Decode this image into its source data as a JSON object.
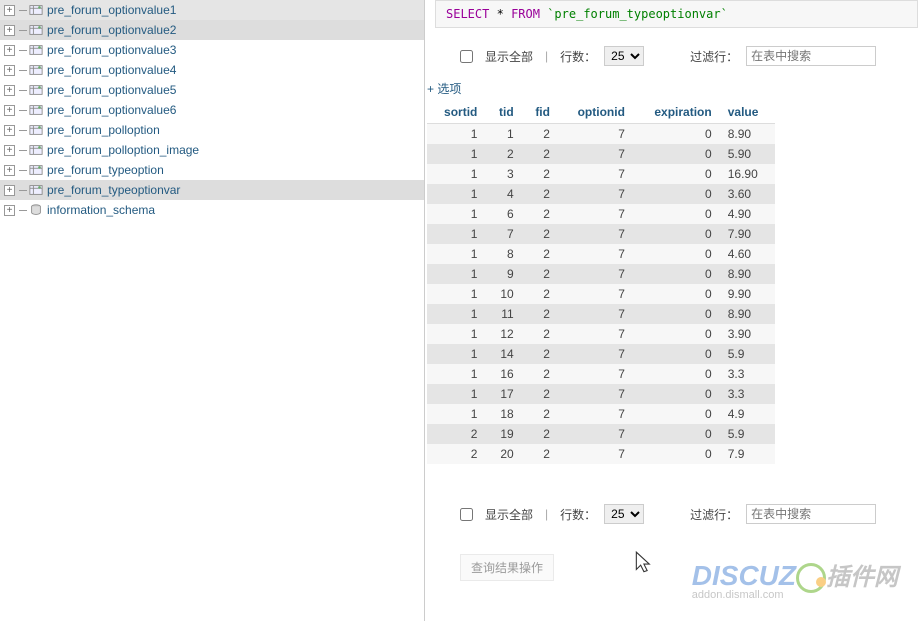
{
  "sql": {
    "select": "SELECT",
    "star": "*",
    "from": "FROM",
    "table": "`pre_forum_typeoptionvar`"
  },
  "controls": {
    "show_all": "显示全部",
    "rows_label": "行数：",
    "rows_value": "25",
    "filter_label": "过滤行：",
    "filter_placeholder": "在表中搜索"
  },
  "options_link": "+ 选项",
  "table": {
    "headers": [
      "sortid",
      "tid",
      "fid",
      "optionid",
      "expiration",
      "value"
    ],
    "rows": [
      [
        "1",
        "1",
        "2",
        "7",
        "0",
        "8.90"
      ],
      [
        "1",
        "2",
        "2",
        "7",
        "0",
        "5.90"
      ],
      [
        "1",
        "3",
        "2",
        "7",
        "0",
        "16.90"
      ],
      [
        "1",
        "4",
        "2",
        "7",
        "0",
        "3.60"
      ],
      [
        "1",
        "6",
        "2",
        "7",
        "0",
        "4.90"
      ],
      [
        "1",
        "7",
        "2",
        "7",
        "0",
        "7.90"
      ],
      [
        "1",
        "8",
        "2",
        "7",
        "0",
        "4.60"
      ],
      [
        "1",
        "9",
        "2",
        "7",
        "0",
        "8.90"
      ],
      [
        "1",
        "10",
        "2",
        "7",
        "0",
        "9.90"
      ],
      [
        "1",
        "11",
        "2",
        "7",
        "0",
        "8.90"
      ],
      [
        "1",
        "12",
        "2",
        "7",
        "0",
        "3.90"
      ],
      [
        "1",
        "14",
        "2",
        "7",
        "0",
        "5.9"
      ],
      [
        "1",
        "16",
        "2",
        "7",
        "0",
        "3.3"
      ],
      [
        "1",
        "17",
        "2",
        "7",
        "0",
        "3.3"
      ],
      [
        "1",
        "18",
        "2",
        "7",
        "0",
        "4.9"
      ],
      [
        "2",
        "19",
        "2",
        "7",
        "0",
        "5.9"
      ],
      [
        "2",
        "20",
        "2",
        "7",
        "0",
        "7.9"
      ]
    ]
  },
  "sidebar": {
    "items": [
      {
        "label": "pre_forum_optionvalue1"
      },
      {
        "label": "pre_forum_optionvalue2"
      },
      {
        "label": "pre_forum_optionvalue3"
      },
      {
        "label": "pre_forum_optionvalue4"
      },
      {
        "label": "pre_forum_optionvalue5"
      },
      {
        "label": "pre_forum_optionvalue6"
      },
      {
        "label": "pre_forum_polloption"
      },
      {
        "label": "pre_forum_polloption_image"
      },
      {
        "label": "pre_forum_typeoption"
      },
      {
        "label": "pre_forum_typeoptionvar"
      }
    ],
    "schema": "information_schema"
  },
  "bottom_button": "查询结果操作",
  "watermark": {
    "text": "DISCUZ",
    "cn": "插件网",
    "sub": "addon.dismall.com"
  }
}
